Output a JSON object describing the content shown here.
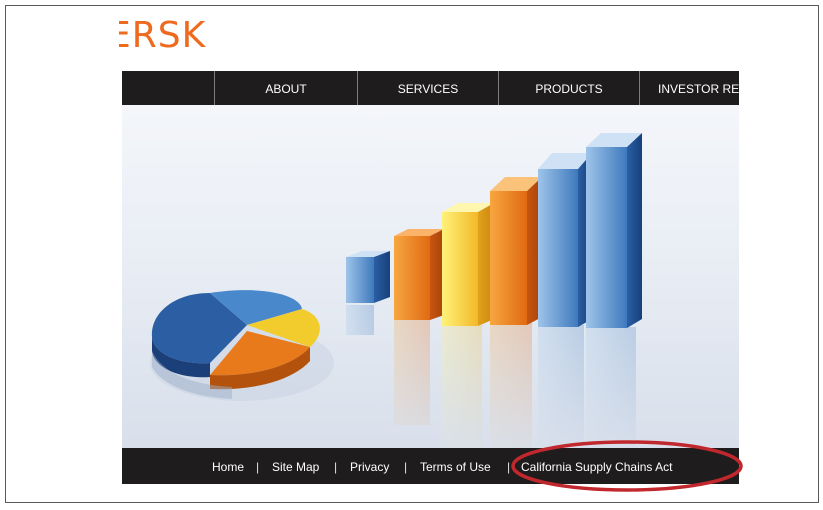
{
  "logo": {
    "text": "ERSK",
    "color": "#ee6a1f"
  },
  "nav": {
    "items": [
      {
        "label": "ABOUT"
      },
      {
        "label": "SERVICES"
      },
      {
        "label": "PRODUCTS"
      },
      {
        "label": "INVESTOR RELATIONS"
      }
    ]
  },
  "hero": {
    "image": "3d-bar-and-pie-chart-illustration"
  },
  "footer": {
    "links": [
      {
        "label": "Home"
      },
      {
        "label": "Site Map"
      },
      {
        "label": "Privacy"
      },
      {
        "label": "Terms of Use"
      },
      {
        "label": "California Supply Chains Act"
      }
    ],
    "separator": "|"
  },
  "annotation": {
    "shape": "ellipse",
    "color": "#c0282d",
    "target": "California Supply Chains Act"
  },
  "colors": {
    "bar_dark": "#1e1c1d",
    "accent": "#ee6a1f",
    "highlight": "#c0282d"
  }
}
